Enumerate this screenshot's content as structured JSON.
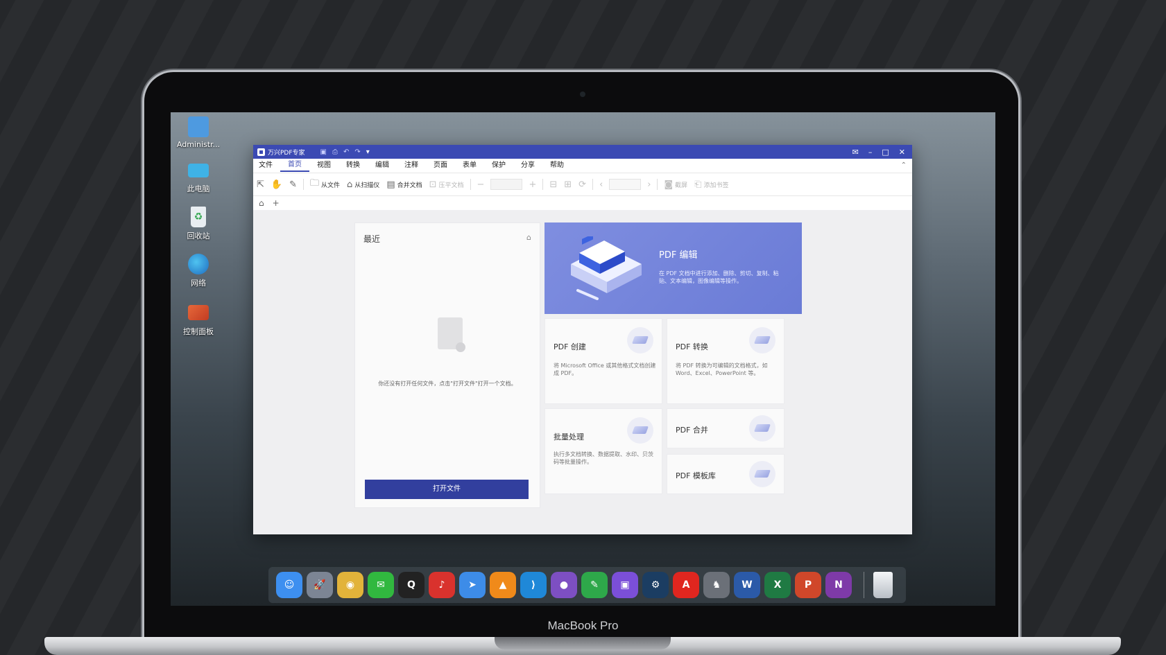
{
  "laptop": {
    "label": "MacBook Pro"
  },
  "desktop": {
    "icons": [
      {
        "label": "Administr...",
        "color": "#4e9ae0",
        "icon": "user-folder-icon"
      },
      {
        "label": "此电脑",
        "color": "#3fb2e6",
        "icon": "computer-icon"
      },
      {
        "label": "回收站",
        "color": "#e9eef2",
        "icon": "recycle-bin-icon"
      },
      {
        "label": "网络",
        "color": "#2e86d6",
        "icon": "network-globe-icon"
      },
      {
        "label": "控制面板",
        "color": "#d44f2a",
        "icon": "control-panel-icon"
      }
    ]
  },
  "app": {
    "title": "万兴PDF专家",
    "menu": [
      "文件",
      "首页",
      "视图",
      "转换",
      "编辑",
      "注释",
      "页面",
      "表单",
      "保护",
      "分享",
      "帮助"
    ],
    "active_menu": "首页",
    "toolbar": {
      "from_file": "从文件",
      "from_scanner": "从扫描仪",
      "merge_docs": "合并文档",
      "flatten_doc": "压平文档",
      "screenshot": "截屏",
      "add_bookmark": "添加书签"
    },
    "recent": {
      "heading": "最近",
      "empty_message": "你还没有打开任何文件，点击\"打开文件\"打开一个文档。",
      "open_button": "打开文件"
    },
    "hero": {
      "title": "PDF 编辑",
      "description": "在 PDF 文档中进行添加、删除、剪切、复制、粘贴、文本编辑，图像编辑等操作。"
    },
    "cards": {
      "create": {
        "title": "PDF 创建",
        "description": "将 Microsoft Office 或其他格式文档创建成 PDF。"
      },
      "convert": {
        "title": "PDF 转换",
        "description": "将 PDF 转换为可编辑的文档格式，如 Word、Excel、PowerPoint 等。"
      },
      "batch": {
        "title": "批量处理",
        "description": "执行多文档转换、数据提取、水印、贝茨码等批量操作。"
      },
      "merge": {
        "title": "PDF 合并"
      },
      "templates": {
        "title": "PDF 模板库"
      }
    }
  },
  "dock": [
    {
      "name": "Finder",
      "icon": "finder-icon",
      "color": "#3d8ff0",
      "glyph": "☺"
    },
    {
      "name": "Launchpad",
      "icon": "rocket-icon",
      "color": "#7c8594",
      "glyph": "🚀"
    },
    {
      "name": "Chrome",
      "icon": "chrome-icon",
      "color": "#e2b33a",
      "glyph": "◉"
    },
    {
      "name": "WeChat",
      "icon": "wechat-icon",
      "color": "#31b83f",
      "glyph": "✉"
    },
    {
      "name": "QQ",
      "icon": "qq-penguin-icon",
      "color": "#222222",
      "glyph": "Q"
    },
    {
      "name": "NetEase Music",
      "icon": "netease-music-icon",
      "color": "#d9322d",
      "glyph": "♪"
    },
    {
      "name": "Mail",
      "icon": "paper-plane-icon",
      "color": "#3d8ce8",
      "glyph": "➤"
    },
    {
      "name": "VLC",
      "icon": "vlc-cone-icon",
      "color": "#f08a1a",
      "glyph": "▲"
    },
    {
      "name": "VS Code",
      "icon": "vscode-icon",
      "color": "#1f88d8",
      "glyph": "⟩"
    },
    {
      "name": "GitHub",
      "icon": "github-icon",
      "color": "#7d4fc2",
      "glyph": "●"
    },
    {
      "name": "Evernote",
      "icon": "evernote-icon",
      "color": "#2ea84a",
      "glyph": "✎"
    },
    {
      "name": "Twitch",
      "icon": "twitch-icon",
      "color": "#7b4fd8",
      "glyph": "▣"
    },
    {
      "name": "Steam",
      "icon": "steam-icon",
      "color": "#1b3d62",
      "glyph": "⚙"
    },
    {
      "name": "Acrobat",
      "icon": "acrobat-icon",
      "color": "#e0261f",
      "glyph": "A"
    },
    {
      "name": "Unicorn",
      "icon": "unicorn-icon",
      "color": "#6b7078",
      "glyph": "♞"
    },
    {
      "name": "Word",
      "icon": "word-icon",
      "color": "#2b5aa8",
      "glyph": "W"
    },
    {
      "name": "Excel",
      "icon": "excel-icon",
      "color": "#1f7a43",
      "glyph": "X"
    },
    {
      "name": "PowerPoint",
      "icon": "powerpoint-icon",
      "color": "#d0472a",
      "glyph": "P"
    },
    {
      "name": "OneNote",
      "icon": "onenote-icon",
      "color": "#7e3aa8",
      "glyph": "N"
    }
  ]
}
